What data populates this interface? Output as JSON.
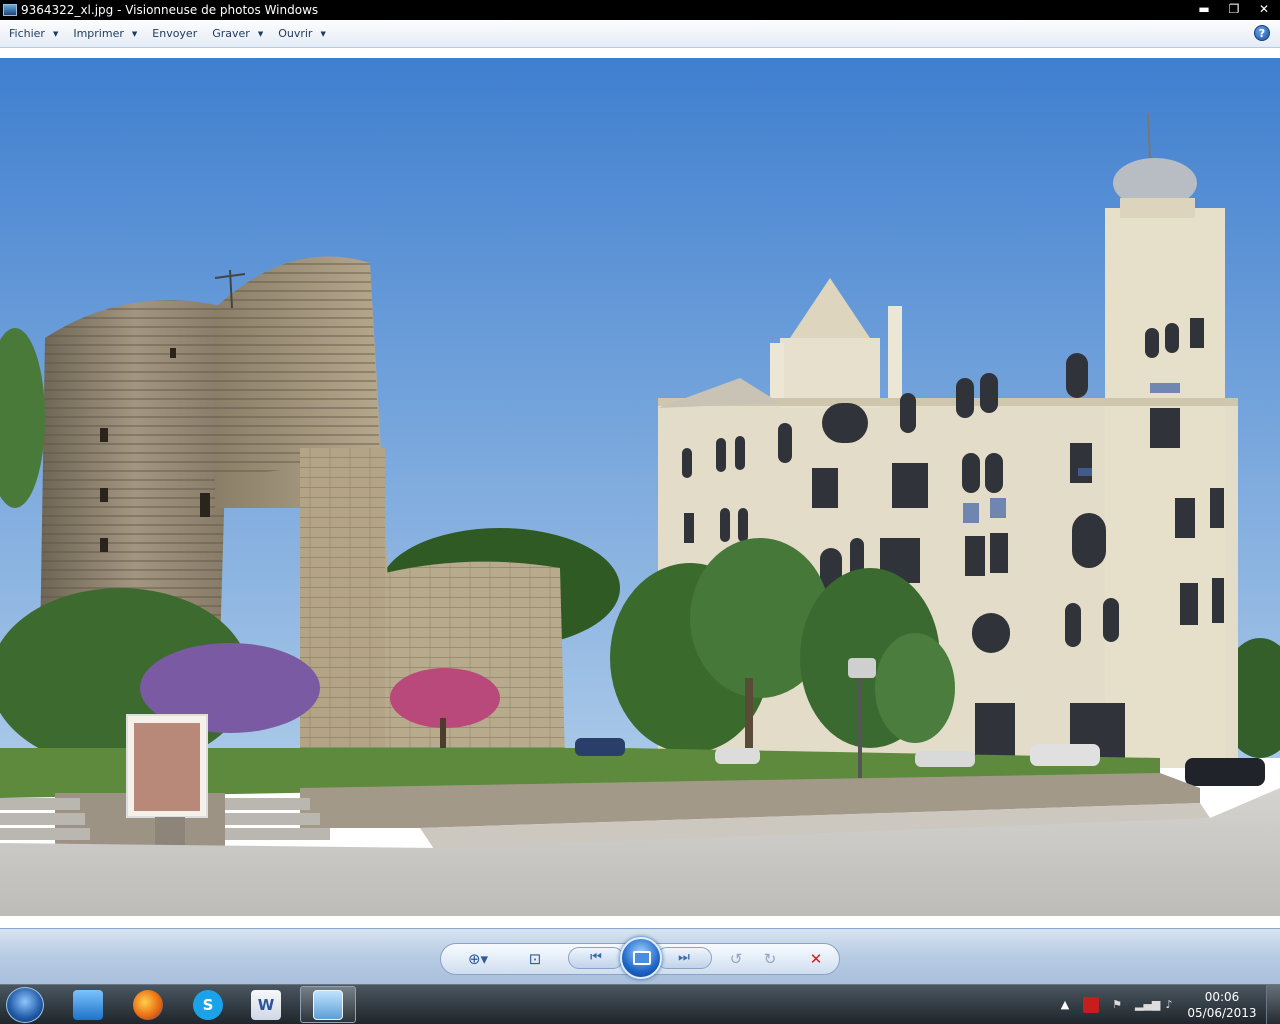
{
  "window": {
    "title": "9364322_xl.jpg - Visionneuse de photos Windows",
    "minimize_glyph": "▬",
    "maximize_glyph": "❐",
    "close_glyph": "✕"
  },
  "menu": {
    "items": [
      {
        "label": "Fichier",
        "has_dropdown": true
      },
      {
        "label": "Imprimer",
        "has_dropdown": true
      },
      {
        "label": "Envoyer",
        "has_dropdown": false
      },
      {
        "label": "Graver",
        "has_dropdown": true
      },
      {
        "label": "Ouvrir",
        "has_dropdown": true
      }
    ],
    "dropdown_glyph": "▼",
    "help_glyph": "?"
  },
  "controls": {
    "zoom_glyph": "⊕▾",
    "fit_glyph": "⊡",
    "prev_glyph": "⏮",
    "next_glyph": "⏭",
    "rotate_left_glyph": "↺",
    "rotate_right_glyph": "↻",
    "delete_glyph": "✕"
  },
  "taskbar": {
    "time": "00:06",
    "date": "05/06/2013",
    "tray_show_hidden_glyph": "▲",
    "apps": [
      "windows-explorer",
      "firefox",
      "skype",
      "microsoft-word",
      "windows-photo-viewer"
    ]
  },
  "colors": {
    "sky": "#5a95d8",
    "stone": "#a89a7e",
    "building": "#e3dcc8",
    "accent": "#1f67c9"
  }
}
